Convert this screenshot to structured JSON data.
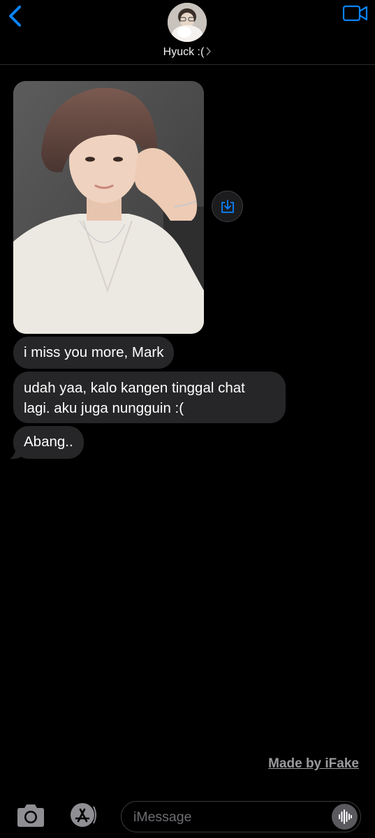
{
  "header": {
    "contact_name": "Hyuck :("
  },
  "messages": [
    {
      "type": "image",
      "description_icon": "photo-attachment"
    },
    {
      "type": "text",
      "text": "i miss you more, Mark"
    },
    {
      "type": "text",
      "text": "udah yaa, kalo kangen tinggal chat lagi. aku juga nungguin :("
    },
    {
      "type": "text",
      "text": "Abang.."
    }
  ],
  "watermark": "Made by iFake",
  "composer": {
    "placeholder": "iMessage"
  },
  "colors": {
    "accent": "#0a84ff",
    "bubble_received": "#262628",
    "background": "#000000"
  }
}
